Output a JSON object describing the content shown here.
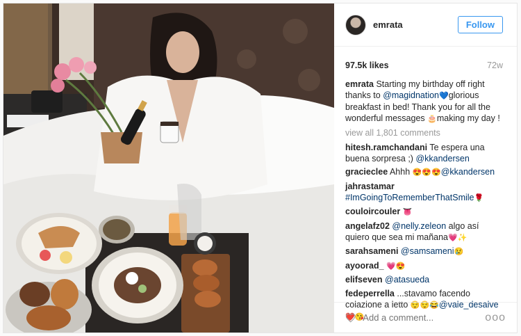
{
  "post": {
    "username": "emrata",
    "follow_label": "Follow",
    "likes": "97.5k likes",
    "age": "72w",
    "view_all": "view all 1,801 comments",
    "add_comment_placeholder": "Add a comment...",
    "more_label": "ooo",
    "heart_icon": "heart-outline-icon",
    "caption": {
      "user": "emrata",
      "t1": " Starting my birthday off right thanks to ",
      "mention": "@magidnation",
      "emoji1": "💙",
      "t2": "glorious breakfast in bed! Thank you for all the wonderful messages ",
      "emoji2": "🎂",
      "t3": "making my day !"
    },
    "comments": [
      {
        "user": "hitesh.ramchandani",
        "t1": " Te espera una buena sorpresa ;) ",
        "mention": "@kkandersen",
        "t2": ""
      },
      {
        "user": "gracieclee",
        "t1": " Ahhh ",
        "emoji": "😍😍😍",
        "mention": "@kkandersen",
        "t2": ""
      },
      {
        "user": "jahrastamar",
        "t1": " ",
        "mention": "#ImGoingToRememberThatSmile",
        "emoji": "🌹",
        "t2": ""
      },
      {
        "user": "couloircouler",
        "t1": " ",
        "emoji": "👅",
        "t2": ""
      },
      {
        "user": "angelafz02",
        "t1": " ",
        "mention": "@nelly.zeleon",
        "t2": " algo así quiero que sea mi mañana",
        "emoji": "💗✨"
      },
      {
        "user": "sarahsameni",
        "t1": " ",
        "mention": "@samsameni",
        "emoji": "😢"
      },
      {
        "user": "ayoorad_",
        "t1": " ",
        "emoji": "💗😍"
      },
      {
        "user": "elifseven",
        "t1": " ",
        "mention": "@atasueda"
      },
      {
        "user": "fedeperrella",
        "t1": " ...stavamo facendo colazione a letto ",
        "emoji": "😌😌😂",
        "mention": "@vale_desalve",
        "emoji2": "❤️😘"
      }
    ]
  }
}
